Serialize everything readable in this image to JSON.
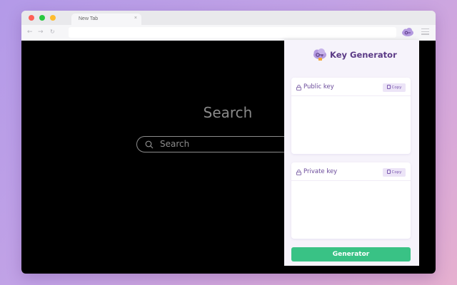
{
  "browser": {
    "tab": {
      "title": "New Tab",
      "close_label": "×"
    },
    "nav": {
      "back": "←",
      "forward": "→",
      "reload": "↻"
    },
    "url": ""
  },
  "page": {
    "heading": "Search",
    "search": {
      "placeholder": "Search"
    }
  },
  "extension": {
    "title": "Key Generator",
    "public_key": {
      "label": "Public key",
      "copy_label": "Copy",
      "value": ""
    },
    "private_key": {
      "label": "Private key",
      "copy_label": "Copy",
      "value": ""
    },
    "generate_label": "Generator",
    "colors": {
      "brand": "#5b3a86",
      "accent": "#39c285",
      "copy_bg": "#ece4f7"
    }
  }
}
